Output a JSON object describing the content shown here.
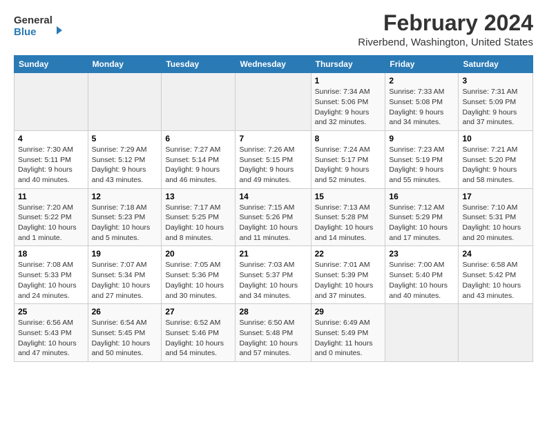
{
  "header": {
    "logo_line1": "General",
    "logo_line2": "Blue",
    "title": "February 2024",
    "subtitle": "Riverbend, Washington, United States"
  },
  "weekdays": [
    "Sunday",
    "Monday",
    "Tuesday",
    "Wednesday",
    "Thursday",
    "Friday",
    "Saturday"
  ],
  "weeks": [
    [
      {
        "num": "",
        "info": "",
        "empty": true
      },
      {
        "num": "",
        "info": "",
        "empty": true
      },
      {
        "num": "",
        "info": "",
        "empty": true
      },
      {
        "num": "",
        "info": "",
        "empty": true
      },
      {
        "num": "1",
        "info": "Sunrise: 7:34 AM\nSunset: 5:06 PM\nDaylight: 9 hours and 32 minutes."
      },
      {
        "num": "2",
        "info": "Sunrise: 7:33 AM\nSunset: 5:08 PM\nDaylight: 9 hours and 34 minutes."
      },
      {
        "num": "3",
        "info": "Sunrise: 7:31 AM\nSunset: 5:09 PM\nDaylight: 9 hours and 37 minutes."
      }
    ],
    [
      {
        "num": "4",
        "info": "Sunrise: 7:30 AM\nSunset: 5:11 PM\nDaylight: 9 hours and 40 minutes."
      },
      {
        "num": "5",
        "info": "Sunrise: 7:29 AM\nSunset: 5:12 PM\nDaylight: 9 hours and 43 minutes."
      },
      {
        "num": "6",
        "info": "Sunrise: 7:27 AM\nSunset: 5:14 PM\nDaylight: 9 hours and 46 minutes."
      },
      {
        "num": "7",
        "info": "Sunrise: 7:26 AM\nSunset: 5:15 PM\nDaylight: 9 hours and 49 minutes."
      },
      {
        "num": "8",
        "info": "Sunrise: 7:24 AM\nSunset: 5:17 PM\nDaylight: 9 hours and 52 minutes."
      },
      {
        "num": "9",
        "info": "Sunrise: 7:23 AM\nSunset: 5:19 PM\nDaylight: 9 hours and 55 minutes."
      },
      {
        "num": "10",
        "info": "Sunrise: 7:21 AM\nSunset: 5:20 PM\nDaylight: 9 hours and 58 minutes."
      }
    ],
    [
      {
        "num": "11",
        "info": "Sunrise: 7:20 AM\nSunset: 5:22 PM\nDaylight: 10 hours and 1 minute."
      },
      {
        "num": "12",
        "info": "Sunrise: 7:18 AM\nSunset: 5:23 PM\nDaylight: 10 hours and 5 minutes."
      },
      {
        "num": "13",
        "info": "Sunrise: 7:17 AM\nSunset: 5:25 PM\nDaylight: 10 hours and 8 minutes."
      },
      {
        "num": "14",
        "info": "Sunrise: 7:15 AM\nSunset: 5:26 PM\nDaylight: 10 hours and 11 minutes."
      },
      {
        "num": "15",
        "info": "Sunrise: 7:13 AM\nSunset: 5:28 PM\nDaylight: 10 hours and 14 minutes."
      },
      {
        "num": "16",
        "info": "Sunrise: 7:12 AM\nSunset: 5:29 PM\nDaylight: 10 hours and 17 minutes."
      },
      {
        "num": "17",
        "info": "Sunrise: 7:10 AM\nSunset: 5:31 PM\nDaylight: 10 hours and 20 minutes."
      }
    ],
    [
      {
        "num": "18",
        "info": "Sunrise: 7:08 AM\nSunset: 5:33 PM\nDaylight: 10 hours and 24 minutes."
      },
      {
        "num": "19",
        "info": "Sunrise: 7:07 AM\nSunset: 5:34 PM\nDaylight: 10 hours and 27 minutes."
      },
      {
        "num": "20",
        "info": "Sunrise: 7:05 AM\nSunset: 5:36 PM\nDaylight: 10 hours and 30 minutes."
      },
      {
        "num": "21",
        "info": "Sunrise: 7:03 AM\nSunset: 5:37 PM\nDaylight: 10 hours and 34 minutes."
      },
      {
        "num": "22",
        "info": "Sunrise: 7:01 AM\nSunset: 5:39 PM\nDaylight: 10 hours and 37 minutes."
      },
      {
        "num": "23",
        "info": "Sunrise: 7:00 AM\nSunset: 5:40 PM\nDaylight: 10 hours and 40 minutes."
      },
      {
        "num": "24",
        "info": "Sunrise: 6:58 AM\nSunset: 5:42 PM\nDaylight: 10 hours and 43 minutes."
      }
    ],
    [
      {
        "num": "25",
        "info": "Sunrise: 6:56 AM\nSunset: 5:43 PM\nDaylight: 10 hours and 47 minutes."
      },
      {
        "num": "26",
        "info": "Sunrise: 6:54 AM\nSunset: 5:45 PM\nDaylight: 10 hours and 50 minutes."
      },
      {
        "num": "27",
        "info": "Sunrise: 6:52 AM\nSunset: 5:46 PM\nDaylight: 10 hours and 54 minutes."
      },
      {
        "num": "28",
        "info": "Sunrise: 6:50 AM\nSunset: 5:48 PM\nDaylight: 10 hours and 57 minutes."
      },
      {
        "num": "29",
        "info": "Sunrise: 6:49 AM\nSunset: 5:49 PM\nDaylight: 11 hours and 0 minutes."
      },
      {
        "num": "",
        "info": "",
        "empty": true
      },
      {
        "num": "",
        "info": "",
        "empty": true
      }
    ]
  ]
}
